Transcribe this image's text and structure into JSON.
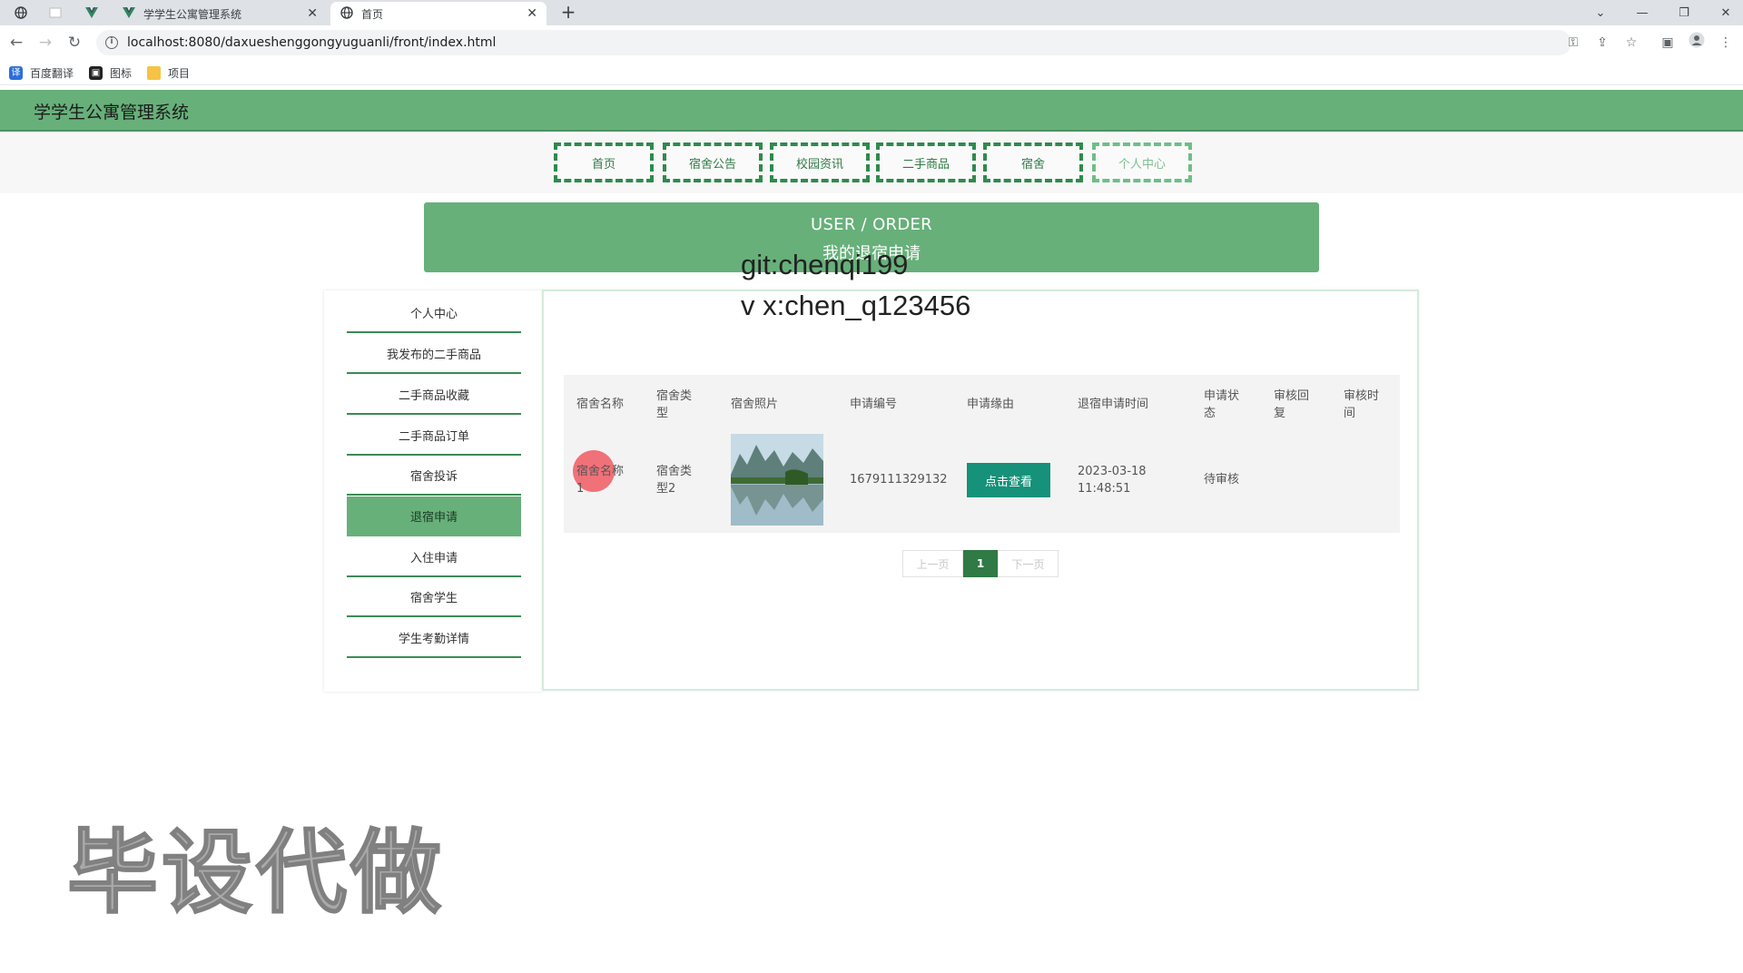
{
  "browser": {
    "tabs": [
      {
        "label": "学学生公寓管理系统"
      },
      {
        "label": "首页"
      }
    ],
    "url": "localhost:8080/daxueshenggongyuguanli/front/index.html",
    "bookmarks": [
      {
        "label": "百度翻译"
      },
      {
        "label": "图标"
      },
      {
        "label": "项目"
      }
    ]
  },
  "site": {
    "title": "学学生公寓管理系统"
  },
  "nav": {
    "items": [
      "首页",
      "宿舍公告",
      "校园资讯",
      "二手商品",
      "宿舍",
      "个人中心"
    ]
  },
  "banner": {
    "line1": "USER / ORDER",
    "line2": "我的退宿申请"
  },
  "overlay": {
    "line1": "git:chenqi199",
    "line2": "v x:chen_q123456",
    "big": "毕设代做"
  },
  "sidebar": {
    "items": [
      "个人中心",
      "我发布的二手商品",
      "二手商品收藏",
      "二手商品订单",
      "宿舍投诉",
      "退宿申请",
      "入住申请",
      "宿舍学生",
      "学生考勤详情"
    ],
    "active": "退宿申请"
  },
  "table": {
    "headers": [
      "宿舍名称",
      "宿舍类型",
      "宿舍照片",
      "申请编号",
      "申请缘由",
      "退宿申请时间",
      "申请状态",
      "审核回复",
      "审核时间"
    ],
    "rows": [
      {
        "name": "宿舍名称1",
        "type": "宿舍类型2",
        "photo": "landscape-photo",
        "number": "1679111329132",
        "reason_button": "点击查看",
        "date": "2023-03-18",
        "time": "11:48:51",
        "status": "待审核",
        "reply": "",
        "review_time": ""
      }
    ]
  },
  "pager": {
    "prev": "上一页",
    "current": "1",
    "next": "下一页"
  },
  "colors": {
    "header_green": "#67b07a",
    "dark_green": "#2f7a45",
    "teal_button": "#16917a"
  }
}
